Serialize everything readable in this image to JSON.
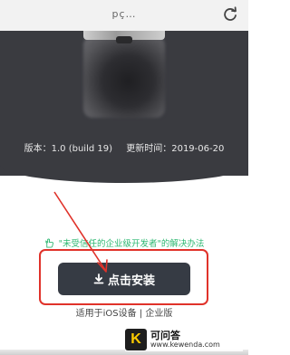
{
  "browser": {
    "address_text": "pç…",
    "reload_icon": "reload-icon"
  },
  "app": {
    "version_label": "版本：1.0 (build 19)",
    "updated_label": "更新时间：2019-06-20"
  },
  "trust_link": {
    "icon": "pointing-hand-icon",
    "text": "\"未受信任的企业级开发者\"的解决办法"
  },
  "install": {
    "icon": "download-icon",
    "label": "点击安装"
  },
  "platform_note": "适用于iOS设备 | 企业版",
  "watermark": {
    "logo_letter": "K",
    "name": "可问答",
    "url": "www.kewenda.com"
  },
  "colors": {
    "hero_bg": "#3a3b40",
    "link_green": "#2eb872",
    "button_bg": "#363b44",
    "annotation_red": "#e0322a"
  }
}
